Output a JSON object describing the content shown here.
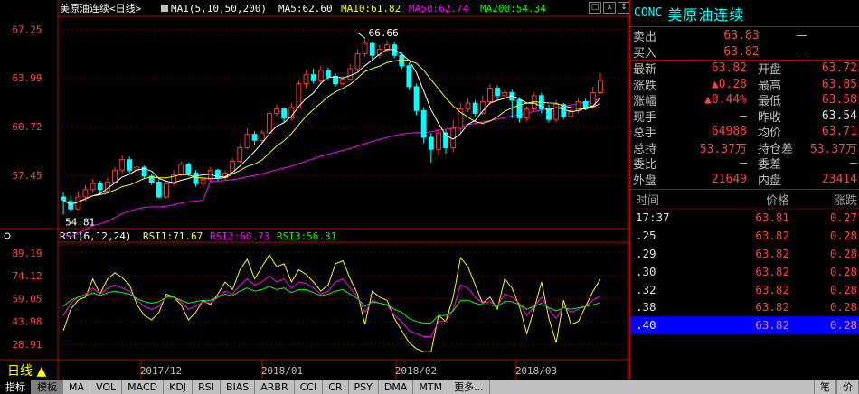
{
  "main_chart": {
    "title": "美原油连续<日线>",
    "ma_label": "MA1(5,10,50,200)",
    "ma5": "MA5:62.60",
    "ma10": "MA10:61.82",
    "ma50": "MA50:62.74",
    "ma200": "MA200:54.34",
    "y_ticks": [
      "67.25",
      "63.99",
      "60.72",
      "57.45"
    ],
    "high_label": "66.66",
    "low_label": "54.81"
  },
  "rsi_chart": {
    "title": "RSI(6,12,24)",
    "rsi1": "RSI1:71.67",
    "rsi2": "RSI2:60.73",
    "rsi3": "RSI3:56.31",
    "y_ticks": [
      "89.19",
      "74.12",
      "59.05",
      "43.98",
      "28.91"
    ]
  },
  "x_labels": [
    "2017/12",
    "2018/01",
    "2018/02",
    "2018/03"
  ],
  "period_label": "日线",
  "window_buttons": [
    "□",
    "x",
    "↕"
  ],
  "panel": {
    "code": "CONC",
    "name": "美原油连续",
    "sell_label": "卖出",
    "sell_price": "63.83",
    "sell_vol": "—",
    "buy_label": "买入",
    "buy_price": "63.82",
    "buy_vol": "—",
    "quote": [
      {
        "l1": "最新",
        "v1": "63.82",
        "c1": "red",
        "l2": "开盘",
        "v2": "63.72",
        "c2": "red"
      },
      {
        "l1": "涨跌",
        "v1": "▲0.28",
        "c1": "red",
        "l2": "最高",
        "v2": "63.85",
        "c2": "red"
      },
      {
        "l1": "涨幅",
        "v1": "▲0.44%",
        "c1": "red",
        "l2": "最低",
        "v2": "63.58",
        "c2": "red"
      },
      {
        "l1": "现手",
        "v1": "—",
        "c1": "grey",
        "l2": "昨收",
        "v2": "63.54",
        "c2": "white"
      },
      {
        "l1": "总手",
        "v1": "64988",
        "c1": "red",
        "l2": "均价",
        "v2": "63.71",
        "c2": "red"
      },
      {
        "l1": "总持",
        "v1": "53.37万",
        "c1": "red",
        "l2": "持仓差",
        "v2": "53.37万",
        "c2": "red"
      },
      {
        "l1": "委比",
        "v1": "—",
        "c1": "grey",
        "l2": "委差",
        "v2": "—",
        "c2": "grey"
      },
      {
        "l1": "外盘",
        "v1": "21649",
        "c1": "red",
        "l2": "内盘",
        "v2": "23414",
        "c2": "red"
      }
    ],
    "tick_header": {
      "time": "时间",
      "price": "价格",
      "change": "涨跌"
    },
    "ticks": [
      {
        "time": "17:37",
        "price": "63.81",
        "change": "0.27"
      },
      {
        "time": ".25",
        "price": "63.82",
        "change": "0.28"
      },
      {
        "time": ".29",
        "price": "63.82",
        "change": "0.28"
      },
      {
        "time": ".30",
        "price": "63.82",
        "change": "0.28"
      },
      {
        "time": ".32",
        "price": "63.82",
        "change": "0.28"
      },
      {
        "time": ".38",
        "price": "63.82",
        "change": "0.28"
      },
      {
        "time": ".40",
        "price": "63.82",
        "change": "0.28"
      }
    ]
  },
  "bottom_tabs": [
    "指标",
    "模板",
    "MA",
    "VOL",
    "MACD",
    "KDJ",
    "RSI",
    "BIAS",
    "ARBR",
    "CCI",
    "CR",
    "PSY",
    "DMA",
    "MTM",
    "更多..."
  ],
  "bottom_right_tabs": [
    "笔",
    "价"
  ],
  "colors": {
    "up": "#ff3333",
    "down": "#00ffff",
    "ma5": "#ffffff",
    "ma10": "#ffff00",
    "ma50": "#ff00ff",
    "ma200": "#00ff00",
    "axis": "#c00000"
  },
  "chart_data": [
    {
      "type": "candlestick",
      "title": "美原油连续<日线>",
      "ylim": [
        54.0,
        68.0
      ],
      "y_ticks": [
        67.25,
        63.99,
        60.72,
        57.45
      ],
      "candles": [
        [
          56.0,
          55.8,
          56.3,
          54.81
        ],
        [
          55.7,
          55.2,
          56.1,
          55.0
        ],
        [
          55.2,
          56.0,
          56.4,
          55.1
        ],
        [
          56.0,
          56.5,
          56.8,
          55.7
        ],
        [
          56.5,
          56.9,
          57.2,
          56.3
        ],
        [
          56.9,
          56.5,
          57.1,
          56.2
        ],
        [
          56.4,
          57.0,
          57.3,
          56.3
        ],
        [
          57.0,
          57.8,
          58.0,
          56.9
        ],
        [
          57.8,
          58.5,
          58.8,
          57.6
        ],
        [
          58.5,
          57.8,
          58.7,
          57.6
        ],
        [
          57.8,
          58.0,
          58.3,
          57.5
        ],
        [
          58.0,
          57.4,
          58.1,
          57.2
        ],
        [
          57.4,
          57.0,
          57.6,
          56.8
        ],
        [
          57.0,
          56.0,
          57.2,
          55.9
        ],
        [
          56.0,
          56.9,
          57.1,
          55.9
        ],
        [
          56.9,
          57.5,
          57.8,
          56.7
        ],
        [
          57.5,
          58.2,
          58.4,
          57.4
        ],
        [
          58.2,
          57.6,
          58.3,
          57.4
        ],
        [
          57.6,
          56.9,
          57.8,
          56.7
        ],
        [
          56.9,
          57.2,
          57.4,
          56.7
        ],
        [
          57.2,
          57.8,
          58.0,
          57.1
        ],
        [
          57.8,
          57.3,
          57.9,
          57.1
        ],
        [
          57.3,
          57.6,
          57.8,
          57.1
        ],
        [
          57.6,
          58.4,
          58.6,
          57.5
        ],
        [
          58.4,
          59.3,
          59.6,
          58.3
        ],
        [
          59.3,
          60.2,
          60.6,
          59.2
        ],
        [
          60.2,
          59.8,
          60.4,
          59.5
        ],
        [
          59.8,
          60.3,
          60.5,
          59.6
        ],
        [
          60.3,
          61.6,
          61.8,
          60.2
        ],
        [
          61.6,
          61.9,
          62.2,
          61.4
        ],
        [
          61.9,
          61.3,
          62.0,
          61.0
        ],
        [
          61.3,
          62.0,
          62.3,
          61.1
        ],
        [
          62.0,
          63.6,
          63.8,
          61.9
        ],
        [
          63.6,
          64.2,
          64.5,
          63.3
        ],
        [
          64.2,
          63.8,
          64.6,
          63.6
        ],
        [
          63.8,
          64.5,
          64.8,
          63.6
        ],
        [
          64.5,
          64.1,
          64.7,
          63.8
        ],
        [
          64.1,
          63.6,
          64.3,
          63.4
        ],
        [
          63.6,
          63.9,
          64.1,
          63.5
        ],
        [
          63.9,
          64.6,
          64.9,
          63.8
        ],
        [
          64.6,
          65.6,
          65.9,
          64.4
        ],
        [
          65.6,
          66.3,
          66.66,
          65.4
        ],
        [
          66.3,
          65.5,
          66.4,
          65.1
        ],
        [
          65.5,
          65.9,
          66.2,
          65.3
        ],
        [
          65.9,
          66.2,
          66.5,
          65.7
        ],
        [
          66.2,
          65.5,
          66.4,
          65.3
        ],
        [
          65.5,
          64.8,
          65.7,
          64.6
        ],
        [
          64.8,
          63.4,
          65.0,
          63.2
        ],
        [
          63.4,
          61.8,
          63.6,
          61.5
        ],
        [
          61.8,
          60.0,
          62.0,
          59.6
        ],
        [
          60.0,
          59.2,
          60.3,
          58.3
        ],
        [
          59.2,
          60.3,
          60.6,
          58.8
        ],
        [
          60.3,
          59.3,
          60.5,
          58.9
        ],
        [
          59.3,
          60.6,
          61.2,
          59.0
        ],
        [
          60.6,
          61.9,
          62.3,
          60.3
        ],
        [
          61.9,
          62.3,
          62.6,
          61.7
        ],
        [
          62.3,
          61.6,
          62.5,
          61.4
        ],
        [
          61.6,
          62.4,
          62.8,
          61.5
        ],
        [
          62.4,
          63.3,
          63.6,
          62.2
        ],
        [
          63.3,
          62.8,
          63.5,
          62.5
        ],
        [
          62.8,
          63.0,
          63.2,
          62.6
        ],
        [
          63.0,
          62.5,
          63.2,
          61.3
        ],
        [
          62.5,
          61.3,
          62.7,
          61.0
        ],
        [
          61.3,
          61.9,
          62.1,
          61.1
        ],
        [
          61.9,
          62.8,
          63.0,
          61.7
        ],
        [
          62.8,
          61.9,
          63.0,
          61.6
        ],
        [
          61.9,
          61.2,
          62.2,
          61.0
        ],
        [
          61.2,
          62.2,
          62.5,
          61.0
        ],
        [
          62.2,
          61.4,
          62.3,
          61.2
        ],
        [
          61.4,
          61.8,
          62.0,
          61.3
        ],
        [
          61.8,
          62.4,
          62.6,
          61.6
        ],
        [
          62.4,
          62.0,
          62.6,
          61.8
        ],
        [
          62.0,
          63.0,
          63.4,
          61.9
        ],
        [
          63.0,
          63.82,
          64.3,
          62.9
        ]
      ]
    },
    {
      "type": "line",
      "title": "RSI(6,12,24)",
      "ylim": [
        20,
        95
      ],
      "y_ticks": [
        89.19,
        74.12,
        59.05,
        43.98,
        28.91
      ],
      "series": [
        {
          "name": "RSI1",
          "values": [
            38,
            52,
            58,
            60,
            72,
            62,
            72,
            76,
            73,
            68,
            55,
            48,
            45,
            50,
            62,
            60,
            55,
            45,
            50,
            58,
            55,
            62,
            70,
            65,
            78,
            85,
            72,
            80,
            88,
            80,
            82,
            70,
            78,
            75,
            70,
            64,
            68,
            82,
            84,
            72,
            62,
            42,
            64,
            60,
            58,
            46,
            38,
            30,
            26,
            24,
            24,
            48,
            44,
            60,
            86,
            80,
            68,
            56,
            60,
            52,
            72,
            66,
            54,
            36,
            52,
            70,
            46,
            30,
            58,
            42,
            44,
            54,
            64,
            71.67
          ]
        },
        {
          "name": "RSI2",
          "values": [
            48,
            56,
            60,
            62,
            66,
            62,
            66,
            68,
            66,
            64,
            58,
            54,
            52,
            54,
            60,
            60,
            57,
            52,
            54,
            57,
            56,
            60,
            64,
            62,
            68,
            72,
            68,
            70,
            74,
            70,
            72,
            66,
            70,
            69,
            66,
            62,
            64,
            70,
            72,
            66,
            60,
            50,
            58,
            56,
            55,
            48,
            44,
            38,
            36,
            34,
            34,
            44,
            44,
            52,
            68,
            66,
            60,
            56,
            57,
            54,
            62,
            60,
            56,
            48,
            54,
            60,
            52,
            46,
            54,
            50,
            52,
            54,
            58,
            60.73
          ]
        },
        {
          "name": "RSI3",
          "values": [
            54,
            58,
            60,
            61,
            63,
            61,
            63,
            64,
            63,
            62,
            59,
            57,
            56,
            57,
            60,
            60,
            58,
            56,
            57,
            58,
            58,
            60,
            62,
            61,
            64,
            66,
            64,
            65,
            67,
            65,
            66,
            63,
            65,
            65,
            63,
            61,
            62,
            64,
            65,
            62,
            59,
            54,
            57,
            56,
            55,
            52,
            50,
            46,
            44,
            43,
            43,
            48,
            48,
            51,
            58,
            58,
            56,
            55,
            55,
            54,
            57,
            57,
            55,
            52,
            54,
            56,
            53,
            51,
            53,
            52,
            53,
            54,
            55,
            56.31
          ]
        }
      ]
    }
  ]
}
